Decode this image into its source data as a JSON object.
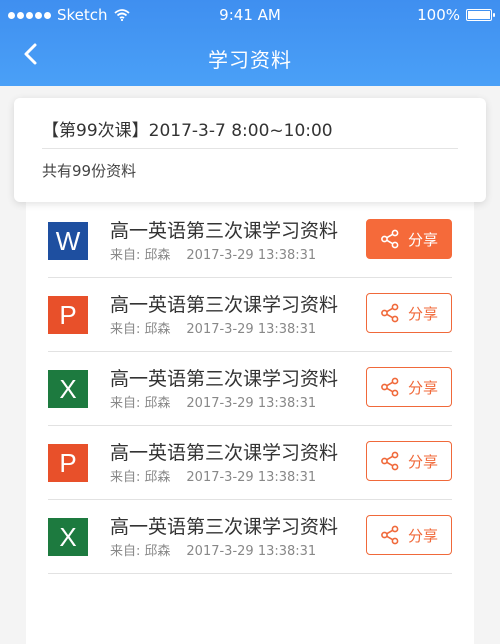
{
  "status_bar": {
    "carrier": "Sketch",
    "time": "9:41 AM",
    "battery": "100%"
  },
  "header": {
    "title": "学习资料"
  },
  "summary": {
    "course_tag": "【第99次课】",
    "course_time": "2017-3-7 8:00~10:00",
    "count_text": "共有99份资料"
  },
  "items": [
    {
      "type_letter": "W",
      "type_color": "#1e4fa0",
      "title": "高一英语第三次课学习资料",
      "from_label": "来自:",
      "author": "邱森",
      "date": "2017-3-29 13:38:31",
      "share_label": "分享",
      "share_active": true
    },
    {
      "type_letter": "P",
      "type_color": "#e8502a",
      "title": "高一英语第三次课学习资料",
      "from_label": "来自:",
      "author": "邱森",
      "date": "2017-3-29 13:38:31",
      "share_label": "分享",
      "share_active": false
    },
    {
      "type_letter": "X",
      "type_color": "#1d7a3f",
      "title": "高一英语第三次课学习资料",
      "from_label": "来自:",
      "author": "邱森",
      "date": "2017-3-29 13:38:31",
      "share_label": "分享",
      "share_active": false
    },
    {
      "type_letter": "P",
      "type_color": "#e8502a",
      "title": "高一英语第三次课学习资料",
      "from_label": "来自:",
      "author": "邱森",
      "date": "2017-3-29 13:38:31",
      "share_label": "分享",
      "share_active": false
    },
    {
      "type_letter": "X",
      "type_color": "#1d7a3f",
      "title": "高一英语第三次课学习资料",
      "from_label": "来自:",
      "author": "邱森",
      "date": "2017-3-29 13:38:31",
      "share_label": "分享",
      "share_active": false
    }
  ],
  "colors": {
    "header": "#4496f4",
    "accent": "#f0693a"
  },
  "icons": {
    "back": "chevron-left-icon",
    "share": "share-icon",
    "wifi": "wifi-icon",
    "battery": "battery-icon"
  }
}
